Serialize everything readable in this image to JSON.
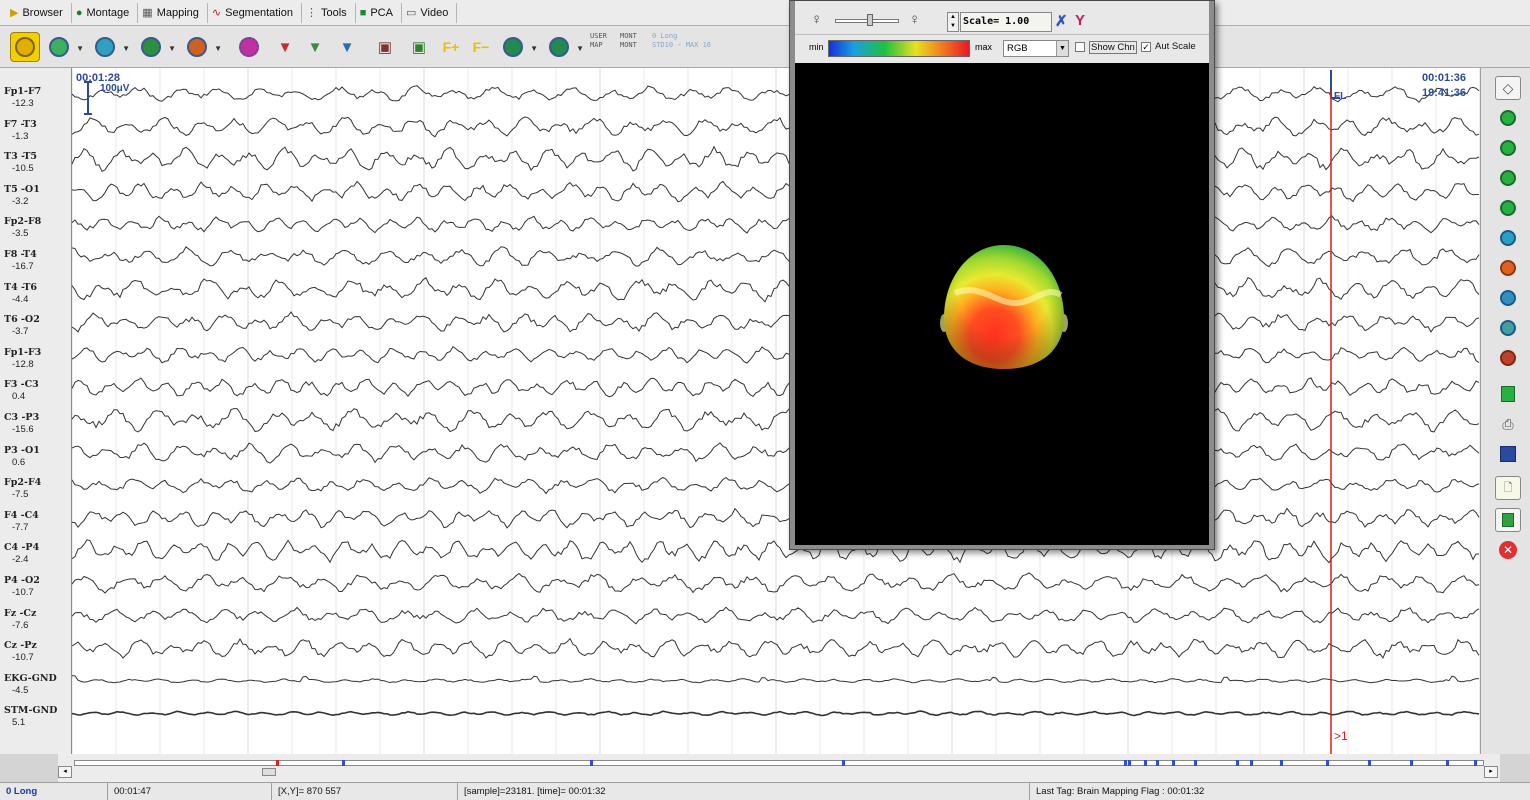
{
  "menu": [
    {
      "label": "Browser",
      "icon": "play-arrow-icon"
    },
    {
      "label": "Montage",
      "icon": "circle-icon"
    },
    {
      "label": "Mapping",
      "icon": "grid-icon"
    },
    {
      "label": "Segmentation",
      "icon": "waveform-icon"
    },
    {
      "label": "Tools",
      "icon": "tools-icon"
    },
    {
      "label": "PCA",
      "icon": "pca-icon"
    },
    {
      "label": "Video",
      "icon": "video-icon"
    }
  ],
  "toolbar": {
    "info_user": "USER",
    "info_map": "MAP",
    "info_mont": "MONT",
    "info_mont2": "MONT",
    "info_long": "0 Long",
    "info_std": "STD10 - MAX 16"
  },
  "channels": [
    {
      "label": "Fp1-F7",
      "value": "-12.3"
    },
    {
      "label": "F7 -T3",
      "value": "-1.3"
    },
    {
      "label": "T3 -T5",
      "value": "-10.5"
    },
    {
      "label": "T5 -O1",
      "value": "-3.2"
    },
    {
      "label": "Fp2-F8",
      "value": "-3.5"
    },
    {
      "label": "F8 -T4",
      "value": "-16.7"
    },
    {
      "label": "T4 -T6",
      "value": "-4.4"
    },
    {
      "label": "T6 -O2",
      "value": "-3.7"
    },
    {
      "label": "Fp1-F3",
      "value": "-12.8"
    },
    {
      "label": "F3 -C3",
      "value": "0.4"
    },
    {
      "label": "C3 -P3",
      "value": "-15.6"
    },
    {
      "label": "P3 -O1",
      "value": "0.6"
    },
    {
      "label": "Fp2-F4",
      "value": "-7.5"
    },
    {
      "label": "F4 -C4",
      "value": "-7.7"
    },
    {
      "label": "C4 -P4",
      "value": "-2.4"
    },
    {
      "label": "P4 -O2",
      "value": "-10.7"
    },
    {
      "label": "Fz -Cz",
      "value": "-7.6"
    },
    {
      "label": "Cz -Pz",
      "value": "-10.7"
    },
    {
      "label": "EKG-GND",
      "value": "-4.5"
    },
    {
      "label": "STM-GND",
      "value": "5.1"
    }
  ],
  "eeg": {
    "start_time": "00:01:28",
    "scale_label": "100μV",
    "end_time": "00:01:36",
    "clock": "19:41:36",
    "marker_label": "FL",
    "cursor_label": ">1"
  },
  "map_window": {
    "scale": "Scale= 1.00",
    "min_label": "min",
    "max_label": "max",
    "color_mode": "RGB",
    "show_chn": "Show Chn",
    "show_chn_checked": false,
    "aut_scale": "Aut Scale",
    "aut_scale_checked": true,
    "check_mark": "✓"
  },
  "status": {
    "montage": "0 Long",
    "duration": "00:01:47",
    "xy": "[X,Y]=  870   557",
    "sample": "[sample]=23181.  [time]= 00:01:32",
    "last_tag": "Last Tag:  Brain Mapping Flag : 00:01:32"
  },
  "colors": {
    "trace": "#333333",
    "grid": "#d8d8d8",
    "cursor": "#e01818",
    "marker": "#2a4a9a",
    "timestamp": "#2a4a9a"
  }
}
